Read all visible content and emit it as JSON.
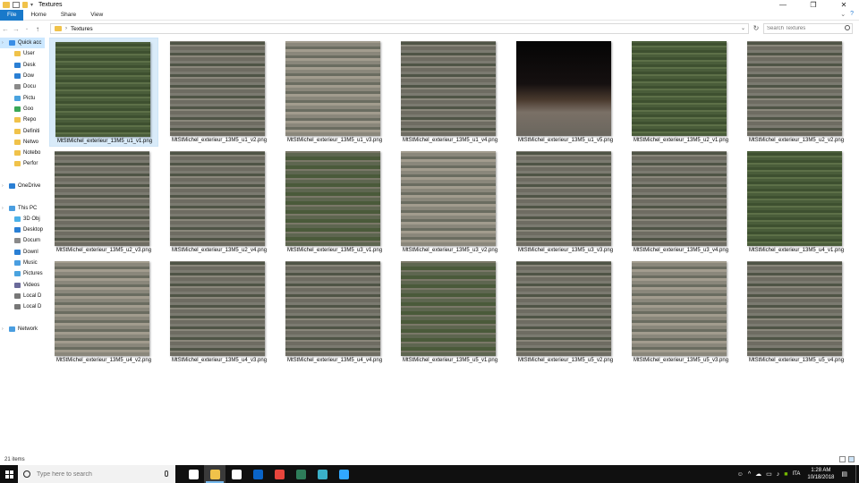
{
  "window": {
    "title": "Textures",
    "controls": [
      "—",
      "❐",
      "✕"
    ]
  },
  "ribbon": {
    "tabs": [
      "File",
      "Home",
      "Share",
      "View"
    ]
  },
  "address": {
    "breadcrumb": "Textures",
    "separator": "›",
    "search_placeholder": "Search Textures"
  },
  "nav": {
    "items": [
      {
        "label": "Quick acc",
        "icon": "star-icon",
        "color": "#3a8ee6",
        "top": true,
        "selected": true
      },
      {
        "label": "User",
        "icon": "folder-icon",
        "color": "#f0c24a"
      },
      {
        "label": "Desk",
        "icon": "desktop-icon",
        "color": "#2a7fd4"
      },
      {
        "label": "Dow",
        "icon": "download-icon",
        "color": "#2a7fd4"
      },
      {
        "label": "Docu",
        "icon": "document-icon",
        "color": "#8a8a8a"
      },
      {
        "label": "Pictu",
        "icon": "pictures-icon",
        "color": "#4aa3df"
      },
      {
        "label": "Goo",
        "icon": "drive-icon",
        "color": "#3aa757"
      },
      {
        "label": "Repo",
        "icon": "folder-icon",
        "color": "#f0c24a"
      },
      {
        "label": "Definiti",
        "icon": "folder-icon",
        "color": "#f0c24a"
      },
      {
        "label": "Netwo",
        "icon": "folder-icon",
        "color": "#f0c24a"
      },
      {
        "label": "Notebo",
        "icon": "folder-icon",
        "color": "#f0c24a"
      },
      {
        "label": "Perfor",
        "icon": "folder-icon",
        "color": "#f0c24a"
      },
      {
        "label": "",
        "icon": "spacer",
        "color": "transparent"
      },
      {
        "label": "OneDrive",
        "icon": "cloud-icon",
        "color": "#2a7fd4",
        "top": true
      },
      {
        "label": "",
        "icon": "spacer",
        "color": "transparent"
      },
      {
        "label": "This PC",
        "icon": "computer-icon",
        "color": "#4a9ee0",
        "top": true
      },
      {
        "label": "3D Obj",
        "icon": "cube-icon",
        "color": "#4ab0e8"
      },
      {
        "label": "Desktop",
        "icon": "desktop-icon",
        "color": "#2a7fd4"
      },
      {
        "label": "Docum",
        "icon": "document-icon",
        "color": "#8a8a8a"
      },
      {
        "label": "Downl",
        "icon": "download-icon",
        "color": "#2a7fd4"
      },
      {
        "label": "Music",
        "icon": "music-icon",
        "color": "#4a9ee0"
      },
      {
        "label": "Pictures",
        "icon": "pictures-icon",
        "color": "#4aa3df"
      },
      {
        "label": "Videos",
        "icon": "video-icon",
        "color": "#6a6a9a"
      },
      {
        "label": "Local D",
        "icon": "drive-icon",
        "color": "#777777"
      },
      {
        "label": "Local D",
        "icon": "drive-icon",
        "color": "#777777"
      },
      {
        "label": "",
        "icon": "spacer",
        "color": "transparent"
      },
      {
        "label": "Network",
        "icon": "network-icon",
        "color": "#4a9ee0",
        "top": true
      }
    ]
  },
  "files": [
    {
      "name": "MtStMichel_exterieur_13M5_u1_v1.png",
      "style": "green",
      "selected": true
    },
    {
      "name": "MtStMichel_exterieur_13M5_u1_v2.png",
      "style": "town"
    },
    {
      "name": "MtStMichel_exterieur_13M5_u1_v3.png",
      "style": "town-light"
    },
    {
      "name": "MtStMichel_exterieur_13M5_u1_v4.png",
      "style": "town"
    },
    {
      "name": "MtStMichel_exterieur_13M5_u1_v5.png",
      "style": "dark"
    },
    {
      "name": "MtStMichel_exterieur_13M5_u2_v1.png",
      "style": "green"
    },
    {
      "name": "MtStMichel_exterieur_13M5_u2_v2.png",
      "style": "town"
    },
    {
      "name": "MtStMichel_exterieur_13M5_u2_v3.png",
      "style": "town"
    },
    {
      "name": "MtStMichel_exterieur_13M5_u2_v4.png",
      "style": "town"
    },
    {
      "name": "MtStMichel_exterieur_13M5_u3_v1.png",
      "style": "town-green"
    },
    {
      "name": "MtStMichel_exterieur_13M5_u3_v2.png",
      "style": "town-light"
    },
    {
      "name": "MtStMichel_exterieur_13M5_u3_v3.png",
      "style": "town"
    },
    {
      "name": "MtStMichel_exterieur_13M5_u3_v4.png",
      "style": "town"
    },
    {
      "name": "MtStMichel_exterieur_13M5_u4_v1.png",
      "style": "green"
    },
    {
      "name": "MtStMichel_exterieur_13M5_u4_v2.png",
      "style": "town-light"
    },
    {
      "name": "MtStMichel_exterieur_13M5_u4_v3.png",
      "style": "town"
    },
    {
      "name": "MtStMichel_exterieur_13M5_u4_v4.png",
      "style": "town"
    },
    {
      "name": "MtStMichel_exterieur_13M5_u5_v1.png",
      "style": "town-green"
    },
    {
      "name": "MtStMichel_exterieur_13M5_u5_v2.png",
      "style": "town"
    },
    {
      "name": "MtStMichel_exterieur_13M5_u5_v3.png",
      "style": "town-light"
    },
    {
      "name": "MtStMichel_exterieur_13M5_u5_v4.png",
      "style": "town"
    }
  ],
  "status": {
    "item_count": "21 items"
  },
  "taskbar": {
    "search_placeholder": "Type here to search",
    "apps": [
      {
        "name": "task-view-icon",
        "color": "#ffffff"
      },
      {
        "name": "file-explorer-icon",
        "color": "#f0c24a",
        "active": true
      },
      {
        "name": "store-icon",
        "color": "#ffffff"
      },
      {
        "name": "outlook-icon",
        "color": "#0a64c8"
      },
      {
        "name": "chrome-icon",
        "color": "#e8453c"
      },
      {
        "name": "app-icon",
        "color": "#2e7d5a"
      },
      {
        "name": "meshlab-icon",
        "color": "#3ab0c8"
      },
      {
        "name": "photoshop-icon",
        "color": "#31a8ff"
      }
    ],
    "language": "ITA",
    "time": "1:28 AM",
    "date": "10/18/2018"
  }
}
